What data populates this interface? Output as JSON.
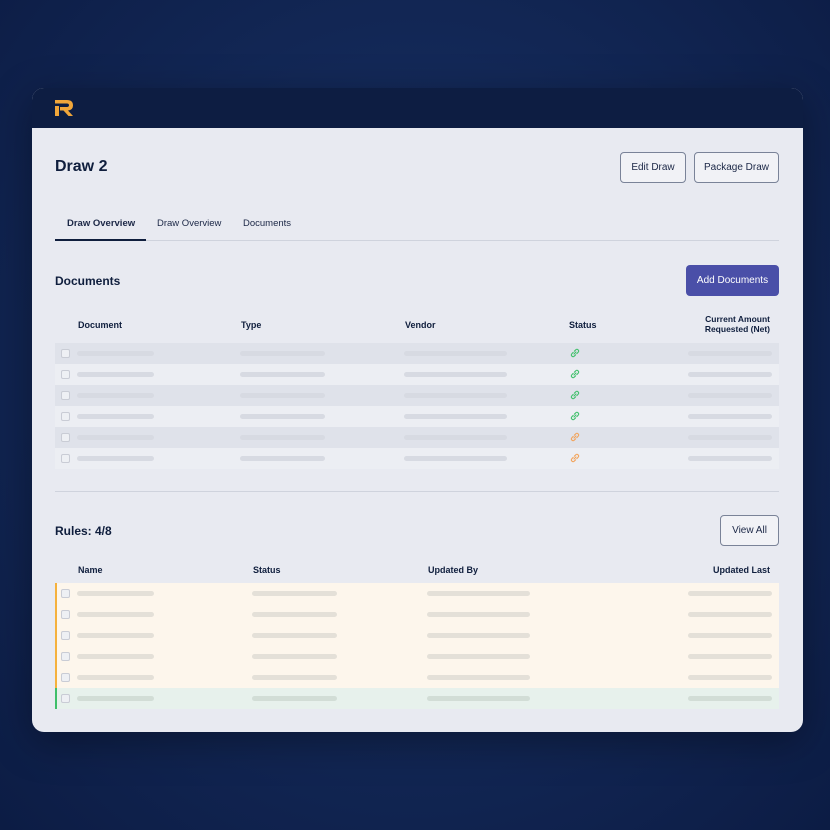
{
  "header": {
    "logo": "R-logo-icon",
    "logo_color": "#f0a63a",
    "bar_color": "#0d1d42"
  },
  "page": {
    "title": "Draw 2"
  },
  "actions": {
    "edit_label": "Edit Draw",
    "package_label": "Package Draw"
  },
  "tabs": [
    {
      "label": "Draw Overview",
      "active": true
    },
    {
      "label": "Draw Overview",
      "active": false
    },
    {
      "label": "Documents",
      "active": false
    }
  ],
  "documents": {
    "title": "Documents",
    "add_label": "Add Documents",
    "add_color": "#4a4fa8",
    "columns": [
      "Document",
      "Type",
      "Vendor",
      "Status",
      "Current Amount Requested (Net)"
    ],
    "column_header_lines": [
      "Current Amount",
      "Requested (Net)"
    ],
    "rows": [
      {
        "status": "linked",
        "status_icon": "link-icon",
        "status_color": "#3fbf6a"
      },
      {
        "status": "linked",
        "status_icon": "link-icon",
        "status_color": "#3fbf6a"
      },
      {
        "status": "linked",
        "status_icon": "link-icon",
        "status_color": "#3fbf6a"
      },
      {
        "status": "linked",
        "status_icon": "link-icon",
        "status_color": "#3fbf6a"
      },
      {
        "status": "pending",
        "status_icon": "link-icon",
        "status_color": "#f2a35a"
      },
      {
        "status": "pending",
        "status_icon": "link-icon",
        "status_color": "#f2a35a"
      }
    ]
  },
  "rules": {
    "title": "Rules: 4/8",
    "view_all_label": "View All",
    "columns": [
      "Name",
      "Status",
      "Updated By",
      "Updated Last"
    ],
    "rows": [
      {
        "state": "warning",
        "accent": "#f5b13c",
        "bg": "#fdf6ec"
      },
      {
        "state": "warning",
        "accent": "#f5b13c",
        "bg": "#fdf6ec"
      },
      {
        "state": "warning",
        "accent": "#f5b13c",
        "bg": "#fdf6ec"
      },
      {
        "state": "warning",
        "accent": "#f5b13c",
        "bg": "#fdf6ec"
      },
      {
        "state": "warning",
        "accent": "#f5b13c",
        "bg": "#fdf6ec"
      },
      {
        "state": "pass",
        "accent": "#3fbf6a",
        "bg": "#e7f1ec"
      }
    ]
  }
}
